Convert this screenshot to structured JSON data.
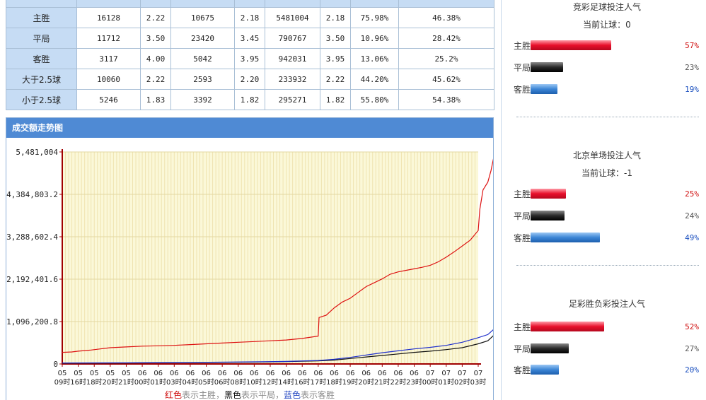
{
  "table": {
    "rows": [
      {
        "label": "主胜",
        "c1": "16128",
        "c2": "2.22",
        "c3": "10675",
        "c4": "2.18",
        "c5": "5481004",
        "c6": "2.18",
        "c7": "75.98%",
        "c8": "46.38%"
      },
      {
        "label": "平局",
        "c1": "11712",
        "c2": "3.50",
        "c3": "23420",
        "c4": "3.45",
        "c5": "790767",
        "c6": "3.50",
        "c7": "10.96%",
        "c8": "28.42%"
      },
      {
        "label": "客胜",
        "c1": "3117",
        "c2": "4.00",
        "c3": "5042",
        "c4": "3.95",
        "c5": "942031",
        "c6": "3.95",
        "c7": "13.06%",
        "c8": "25.2%"
      },
      {
        "label": "大于2.5球",
        "c1": "10060",
        "c2": "2.22",
        "c3": "2593",
        "c4": "2.20",
        "c5": "233932",
        "c6": "2.22",
        "c7": "44.20%",
        "c8": "45.62%"
      },
      {
        "label": "小于2.5球",
        "c1": "5246",
        "c2": "1.83",
        "c3": "3392",
        "c4": "1.82",
        "c5": "295271",
        "c6": "1.82",
        "c7": "55.80%",
        "c8": "54.38%"
      }
    ]
  },
  "chart_panel": {
    "title": "成交额走势图",
    "caption": {
      "red": "红色",
      "t1": "表示主胜，",
      "black": "黑色",
      "t2": "表示平局，",
      "blue": "蓝色",
      "t3": "表示客胜"
    }
  },
  "chart_data": {
    "type": "line",
    "title": "",
    "xlabel": "",
    "ylabel": "",
    "ylim": [
      0,
      5481004
    ],
    "y_ticks": [
      "0",
      "1,096,200.8",
      "2,192,401.6",
      "3,288,602.4",
      "4,384,803.2",
      "5,481,004"
    ],
    "x_ticks": [
      [
        "05",
        "09时"
      ],
      [
        "05",
        "16时"
      ],
      [
        "05",
        "18时"
      ],
      [
        "05",
        "20时"
      ],
      [
        "05",
        "21时"
      ],
      [
        "06",
        "00时"
      ],
      [
        "06",
        "01时"
      ],
      [
        "06",
        "03时"
      ],
      [
        "06",
        "04时"
      ],
      [
        "06",
        "05时"
      ],
      [
        "06",
        "06时"
      ],
      [
        "06",
        "08时"
      ],
      [
        "06",
        "10时"
      ],
      [
        "06",
        "12时"
      ],
      [
        "06",
        "14时"
      ],
      [
        "06",
        "16时"
      ],
      [
        "06",
        "17时"
      ],
      [
        "06",
        "18时"
      ],
      [
        "06",
        "19时"
      ],
      [
        "06",
        "20时"
      ],
      [
        "06",
        "21时"
      ],
      [
        "06",
        "22时"
      ],
      [
        "06",
        "23时"
      ],
      [
        "07",
        "00时"
      ],
      [
        "07",
        "01时"
      ],
      [
        "07",
        "02时"
      ],
      [
        "07",
        "03时"
      ]
    ],
    "grid": true,
    "series": [
      {
        "color": "#dd1111",
        "values": [
          [
            0,
            300000
          ],
          [
            0.6,
            310000
          ],
          [
            1,
            330000
          ],
          [
            1.8,
            360000
          ],
          [
            2.2,
            380000
          ],
          [
            3,
            420000
          ],
          [
            4,
            440000
          ],
          [
            5,
            460000
          ],
          [
            6,
            470000
          ],
          [
            7,
            480000
          ],
          [
            8,
            500000
          ],
          [
            9,
            520000
          ],
          [
            10,
            540000
          ],
          [
            11,
            560000
          ],
          [
            12,
            580000
          ],
          [
            13,
            600000
          ],
          [
            14,
            620000
          ],
          [
            15,
            660000
          ],
          [
            16,
            720000
          ],
          [
            16.05,
            1200000
          ],
          [
            16.5,
            1260000
          ],
          [
            17,
            1450000
          ],
          [
            17.5,
            1600000
          ],
          [
            18,
            1700000
          ],
          [
            18.5,
            1850000
          ],
          [
            19,
            2000000
          ],
          [
            19.5,
            2100000
          ],
          [
            20,
            2200000
          ],
          [
            20.5,
            2320000
          ],
          [
            21,
            2380000
          ],
          [
            21.5,
            2420000
          ],
          [
            22,
            2460000
          ],
          [
            22.5,
            2500000
          ],
          [
            23,
            2550000
          ],
          [
            23.5,
            2640000
          ],
          [
            24,
            2760000
          ],
          [
            24.5,
            2900000
          ],
          [
            25,
            3050000
          ],
          [
            25.5,
            3200000
          ],
          [
            26,
            3450000
          ],
          [
            26.1,
            4000000
          ],
          [
            26.3,
            4500000
          ],
          [
            26.6,
            4700000
          ],
          [
            26.8,
            5000000
          ],
          [
            27,
            5400000
          ],
          [
            27.1,
            5481004
          ]
        ]
      },
      {
        "color": "#111111",
        "values": [
          [
            0,
            20000
          ],
          [
            4,
            25000
          ],
          [
            8,
            35000
          ],
          [
            12,
            50000
          ],
          [
            14,
            60000
          ],
          [
            16,
            80000
          ],
          [
            17,
            100000
          ],
          [
            18,
            140000
          ],
          [
            19,
            180000
          ],
          [
            20,
            220000
          ],
          [
            21,
            260000
          ],
          [
            22,
            300000
          ],
          [
            23,
            330000
          ],
          [
            24,
            370000
          ],
          [
            25,
            420000
          ],
          [
            26,
            520000
          ],
          [
            26.6,
            600000
          ],
          [
            27.1,
            790767
          ]
        ]
      },
      {
        "color": "#1f2fcc",
        "values": [
          [
            0,
            25000
          ],
          [
            4,
            30000
          ],
          [
            8,
            40000
          ],
          [
            12,
            55000
          ],
          [
            14,
            65000
          ],
          [
            16,
            90000
          ],
          [
            17,
            120000
          ],
          [
            18,
            170000
          ],
          [
            19,
            230000
          ],
          [
            20,
            290000
          ],
          [
            21,
            340000
          ],
          [
            22,
            390000
          ],
          [
            23,
            430000
          ],
          [
            24,
            480000
          ],
          [
            25,
            560000
          ],
          [
            26,
            680000
          ],
          [
            26.6,
            760000
          ],
          [
            27.1,
            942031
          ]
        ]
      }
    ]
  },
  "sections": [
    {
      "title": "竞彩足球投注人气",
      "handicap": "当前让球：0",
      "items": [
        {
          "label": "主胜",
          "pct": "57%",
          "value": 0.57
        },
        {
          "label": "平局",
          "pct": "23%",
          "value": 0.23
        },
        {
          "label": "客胜",
          "pct": "19%",
          "value": 0.19
        }
      ]
    },
    {
      "title": "北京单场投注人气",
      "handicap": "当前让球：-1",
      "items": [
        {
          "label": "主胜",
          "pct": "25%",
          "value": 0.25
        },
        {
          "label": "平局",
          "pct": "24%",
          "value": 0.24
        },
        {
          "label": "客胜",
          "pct": "49%",
          "value": 0.49
        }
      ]
    },
    {
      "title": "足彩胜负彩投注人气",
      "handicap": "",
      "items": [
        {
          "label": "主胜",
          "pct": "52%",
          "value": 0.52
        },
        {
          "label": "平局",
          "pct": "27%",
          "value": 0.27
        },
        {
          "label": "客胜",
          "pct": "20%",
          "value": 0.2
        }
      ]
    }
  ]
}
